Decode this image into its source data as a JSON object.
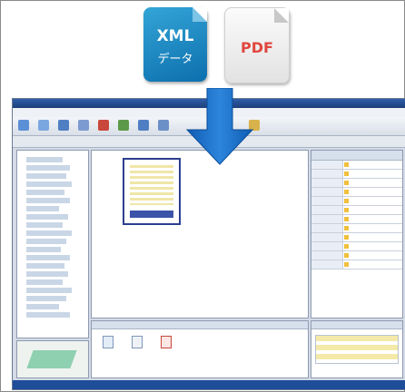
{
  "icons": {
    "xml_line1": "XML",
    "xml_line2": "データ",
    "pdf": "PDF",
    "xml_color": "#1a86c4",
    "pdf_text_color": "#e0463e"
  },
  "arrow_color": "#1b6fc6",
  "app": {
    "title": "",
    "menu": "",
    "toolbar2": "",
    "status": ""
  }
}
